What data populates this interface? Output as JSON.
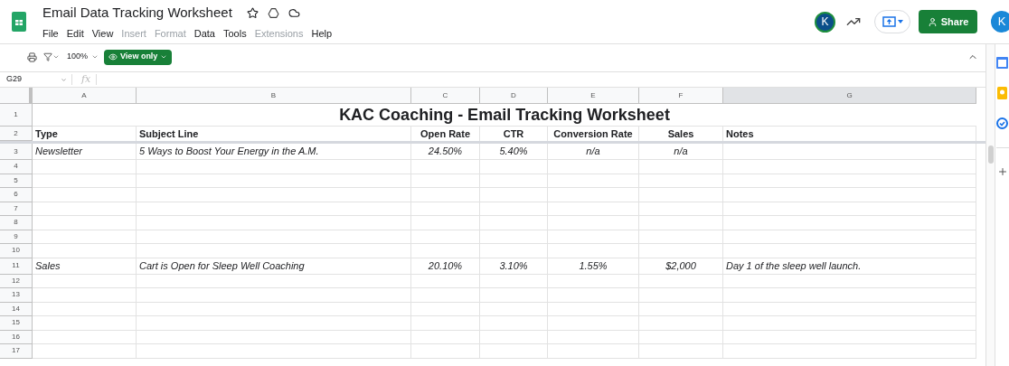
{
  "document": {
    "title": "Email Data Tracking Worksheet"
  },
  "menu": [
    {
      "label": "File",
      "disabled": false
    },
    {
      "label": "Edit",
      "disabled": false
    },
    {
      "label": "View",
      "disabled": false
    },
    {
      "label": "Insert",
      "disabled": true
    },
    {
      "label": "Format",
      "disabled": true
    },
    {
      "label": "Data",
      "disabled": false
    },
    {
      "label": "Tools",
      "disabled": false
    },
    {
      "label": "Extensions",
      "disabled": true
    },
    {
      "label": "Help",
      "disabled": false
    }
  ],
  "header": {
    "avatar": "K",
    "share": "Share",
    "account": "K"
  },
  "toolbar": {
    "zoom": "100%",
    "mode": "View only"
  },
  "formula_bar": {
    "cell": "G29",
    "fx": "fx"
  },
  "columns": [
    {
      "letter": "A",
      "selected": false
    },
    {
      "letter": "B",
      "selected": false
    },
    {
      "letter": "C",
      "selected": false
    },
    {
      "letter": "D",
      "selected": false
    },
    {
      "letter": "E",
      "selected": false
    },
    {
      "letter": "F",
      "selected": false
    },
    {
      "letter": "G",
      "selected": true
    }
  ],
  "sheet_title": {
    "number": "1",
    "text": "KAC Coaching - Email Tracking Worksheet"
  },
  "header_row": {
    "number": "2",
    "cells": [
      "Type",
      "Subject Line",
      "Open Rate",
      "CTR",
      "Conversion Rate",
      "Sales",
      "Notes"
    ]
  },
  "rows": [
    {
      "number": "3",
      "cells": [
        "Newsletter",
        "5 Ways to Boost Your Energy in the A.M.",
        "24.50%",
        "5.40%",
        "n/a",
        "n/a"
      ]
    },
    {
      "number": "4"
    },
    {
      "number": "5"
    },
    {
      "number": "6"
    },
    {
      "number": "7"
    },
    {
      "number": "8"
    },
    {
      "number": "9"
    },
    {
      "number": "10"
    },
    {
      "number": "11",
      "cells": [
        "Sales",
        "Cart is Open for Sleep Well Coaching",
        "20.10%",
        "3.10%",
        "1.55%",
        "$2,000",
        "Day 1 of the sleep well launch."
      ]
    },
    {
      "number": "12"
    },
    {
      "number": "13"
    },
    {
      "number": "14"
    },
    {
      "number": "15"
    },
    {
      "number": "16"
    },
    {
      "number": "17"
    }
  ]
}
